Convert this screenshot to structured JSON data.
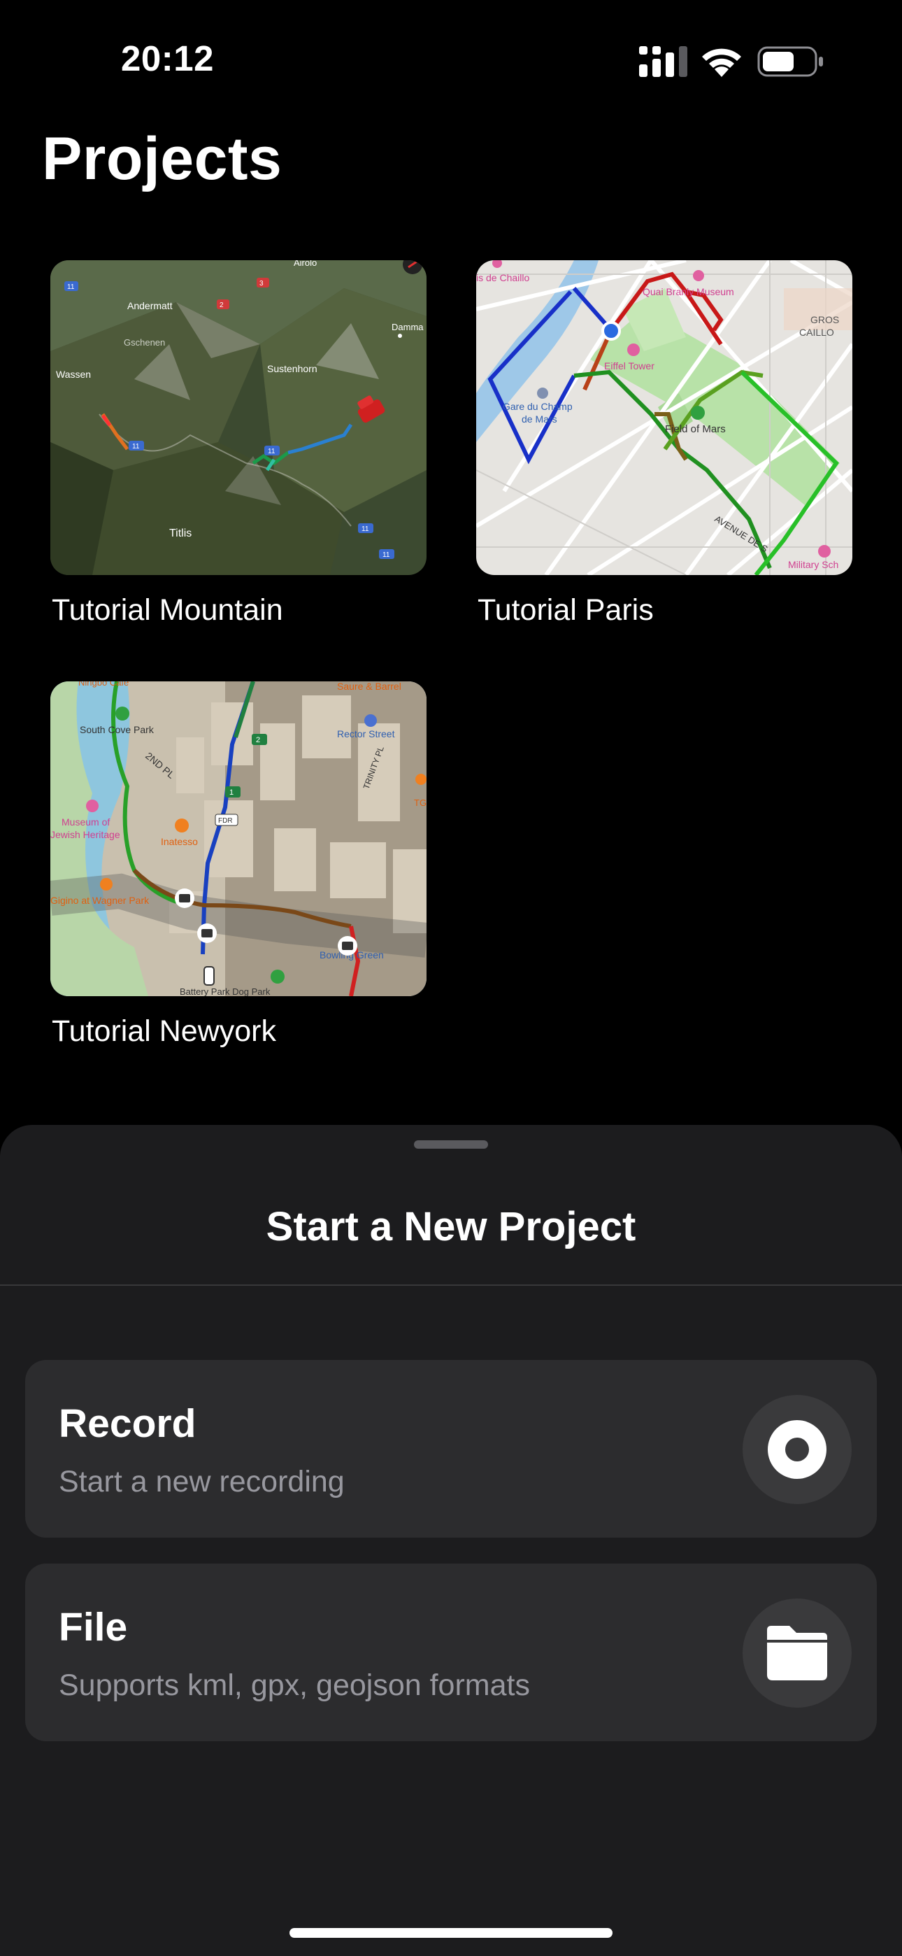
{
  "status_bar": {
    "time": "20:12",
    "icons": [
      "signal-icon",
      "wifi-icon",
      "battery-icon"
    ]
  },
  "header": {
    "title": "Projects"
  },
  "projects": [
    {
      "name": "Tutorial Mountain",
      "thumbnail": "mountain-map-thumbnail",
      "map_labels": [
        "Andermatt",
        "Airolo",
        "Gschenen",
        "Sustenhorn",
        "Wassen",
        "Titlis",
        "Damma",
        "11",
        "2",
        "3"
      ]
    },
    {
      "name": "Tutorial Paris",
      "thumbnail": "paris-map-thumbnail",
      "map_labels": [
        "Quai Branly Museum",
        "Eiffel Tower",
        "Gare du Champ de Mars",
        "Field of Mars",
        "AVENUE DE S",
        "Military Sch",
        "GROS CAILLO",
        "is de Chaillo"
      ]
    },
    {
      "name": "Tutorial Newyork",
      "thumbnail": "newyork-map-thumbnail",
      "map_labels": [
        "South Cove Park",
        "2ND PL",
        "Museum of Jewish Heritage",
        "Inatesso",
        "Gigino at Wagner Park",
        "Rector Street",
        "TRINITY PL",
        "Bowling Green",
        "Saure & Barrel",
        "FDR",
        "1",
        "2",
        "Battery Park Dog Park",
        "TGI",
        "Ningbo Cafe"
      ]
    }
  ],
  "sheet": {
    "title": "Start a New Project",
    "options": [
      {
        "title": "Record",
        "subtitle": "Start a new recording",
        "icon": "record-icon"
      },
      {
        "title": "File",
        "subtitle": "Supports kml, gpx, geojson formats",
        "icon": "folder-icon"
      }
    ]
  },
  "colors": {
    "background": "#000000",
    "sheet": "#1c1c1e",
    "card": "#2c2c2e",
    "icon_circle": "#3a3a3c",
    "subtitle": "#98989f"
  }
}
